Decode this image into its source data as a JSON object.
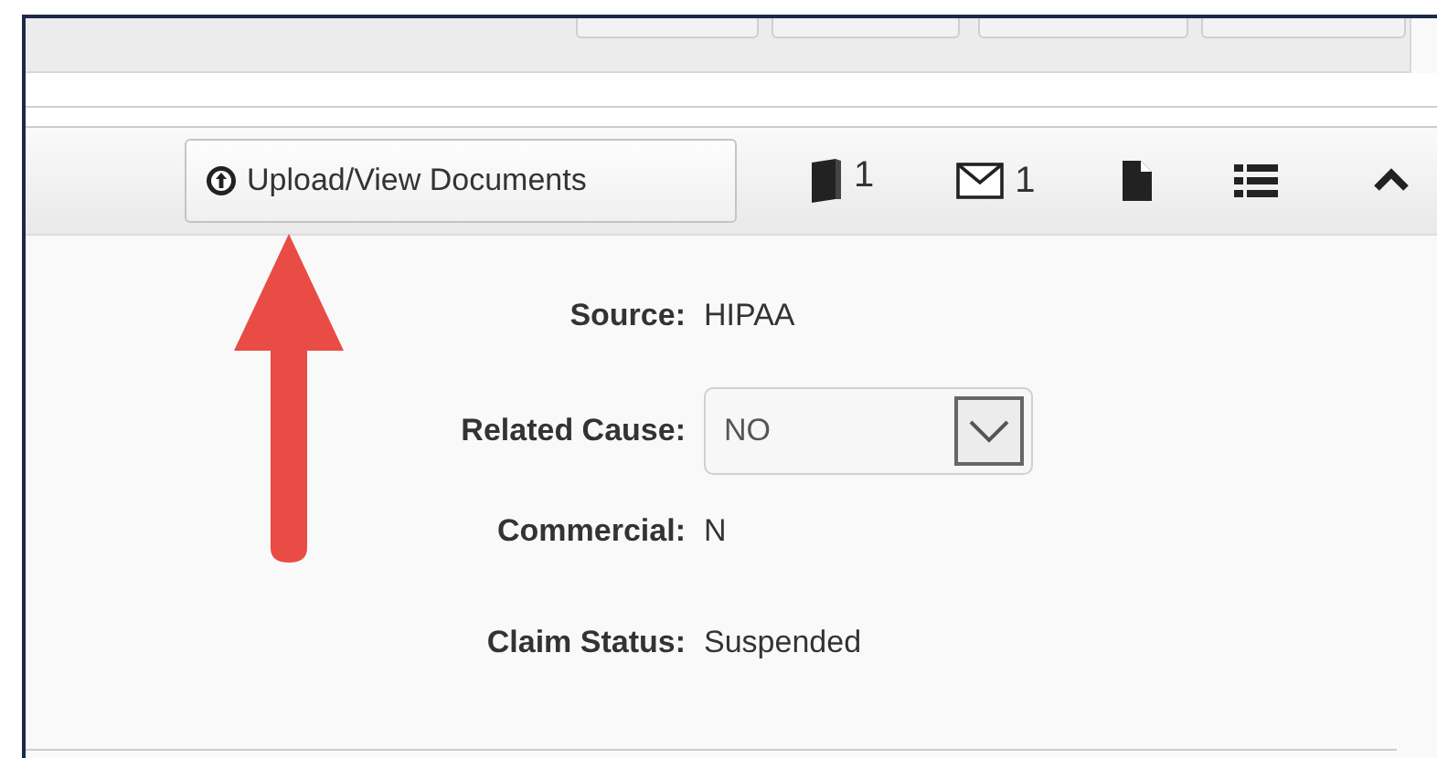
{
  "toolbar": {
    "upload_button": {
      "label": "Upload/View Documents"
    },
    "items": [
      {
        "kind": "book",
        "count": "1"
      },
      {
        "kind": "mail",
        "count": "1"
      },
      {
        "kind": "file"
      },
      {
        "kind": "list"
      },
      {
        "kind": "collapse"
      }
    ]
  },
  "fields": [
    {
      "kind": "text",
      "label": "Source:",
      "value": "HIPAA"
    },
    {
      "kind": "select",
      "label": "Related Cause:",
      "value": "NO"
    },
    {
      "kind": "text",
      "label": "Commercial:",
      "value": "N"
    },
    {
      "kind": "text",
      "label": "Claim Status:",
      "value": "Suspended"
    }
  ]
}
